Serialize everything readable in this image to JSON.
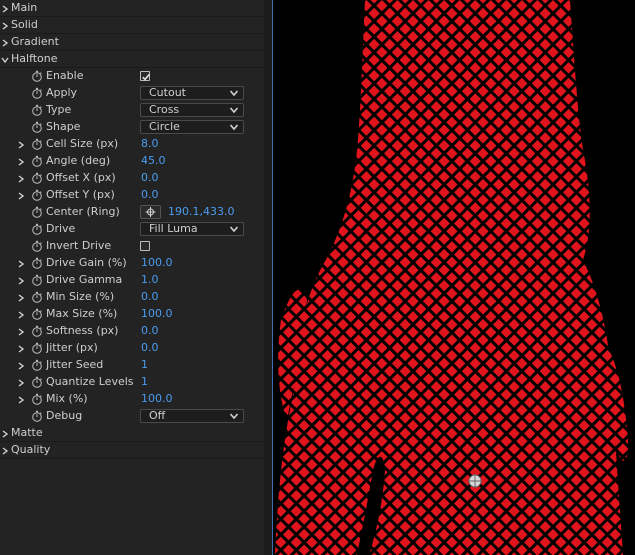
{
  "groups_top": [
    {
      "name": "Main"
    },
    {
      "name": "Solid"
    },
    {
      "name": "Gradient"
    }
  ],
  "halftone": {
    "name": "Halftone",
    "params": [
      {
        "label": "Enable",
        "kind": "checkbox",
        "checked": true
      },
      {
        "label": "Apply",
        "kind": "dropdown",
        "value": "Cutout"
      },
      {
        "label": "Type",
        "kind": "dropdown",
        "value": "Cross"
      },
      {
        "label": "Shape",
        "kind": "dropdown",
        "value": "Circle"
      },
      {
        "label": "Cell Size (px)",
        "kind": "number",
        "value": "8.0",
        "expandable": true
      },
      {
        "label": "Angle (deg)",
        "kind": "number",
        "value": "45.0",
        "expandable": true
      },
      {
        "label": "Offset X (px)",
        "kind": "number",
        "value": "0.0",
        "expandable": true
      },
      {
        "label": "Offset Y (px)",
        "kind": "number",
        "value": "0.0",
        "expandable": true
      },
      {
        "label": "Center (Ring)",
        "kind": "point",
        "value": "190.1,433.0"
      },
      {
        "label": "Drive",
        "kind": "dropdown",
        "value": "Fill Luma"
      },
      {
        "label": "Invert Drive",
        "kind": "checkbox",
        "checked": false
      },
      {
        "label": "Drive Gain (%)",
        "kind": "number",
        "value": "100.0",
        "expandable": true
      },
      {
        "label": "Drive Gamma",
        "kind": "number",
        "value": "1.0",
        "expandable": true
      },
      {
        "label": "Min Size (%)",
        "kind": "number",
        "value": "0.0",
        "expandable": true
      },
      {
        "label": "Max Size (%)",
        "kind": "number",
        "value": "100.0",
        "expandable": true
      },
      {
        "label": "Softness (px)",
        "kind": "number",
        "value": "0.0",
        "expandable": true
      },
      {
        "label": "Jitter (px)",
        "kind": "number",
        "value": "0.0",
        "expandable": true
      },
      {
        "label": "Jitter Seed",
        "kind": "number",
        "value": "1",
        "expandable": true
      },
      {
        "label": "Quantize Levels (1",
        "kind": "number",
        "value": "1",
        "expandable": true
      },
      {
        "label": "Mix (%)",
        "kind": "number",
        "value": "100.0",
        "expandable": true
      },
      {
        "label": "Debug",
        "kind": "dropdown",
        "value": "Off"
      }
    ]
  },
  "groups_bottom": [
    {
      "name": "Matte"
    },
    {
      "name": "Quality"
    }
  ],
  "colors": {
    "accent_value": "#4a9cf0",
    "pattern_red": "#e0141c",
    "panel_bg": "#232323",
    "viewer_bg": "#000000",
    "viewer_border": "#3d6fb0"
  },
  "icons": {
    "group_twirl": "chevron-right-icon",
    "open_twirl": "chevron-down-icon",
    "stopwatch": "stopwatch-icon",
    "point_target": "crosshair-icon"
  }
}
